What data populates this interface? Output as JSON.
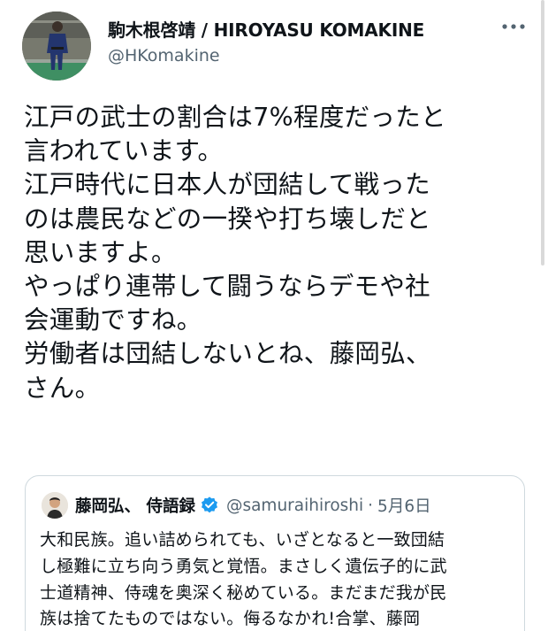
{
  "author": {
    "display_name": "駒木根啓靖 / HIROYASU KOMAKINE",
    "handle": "@HKomakine",
    "avatar_icon": "judo-athlete-photo-avatar"
  },
  "more_icon": "more-horizontal-icon",
  "tweet": {
    "lines": [
      "江戸の武士の割合は7%程度だったと",
      "言われています。",
      "江戸時代に日本人が団結して戦った",
      "のは農民などの一揆や打ち壊しだと",
      "思いますよ。",
      "やっぱり連帯して闘うならデモや社",
      "会運動ですね。",
      "労働者は団結しないとね、藤岡弘、",
      "さん。"
    ]
  },
  "quote": {
    "display_name": "藤岡弘、 侍語録",
    "verified_icon": "verified-badge-icon",
    "verified_color": "#1d9bf0",
    "handle": "@samuraihiroshi",
    "separator": "·",
    "date": "5月6日",
    "lines": [
      "大和民族。追い詰められても、いざとなると一致団結",
      "し極難に立ち向う勇気と覚悟。まさしく遺伝子的に武",
      "士道精神、侍魂を奥深く秘めている。まだまだ我が民",
      "族は捨てたものではない。侮るなかれ!合掌、藤岡"
    ]
  },
  "colors": {
    "text": "#0f1419",
    "secondary": "#536471",
    "border": "#cfd9de",
    "accent": "#1d9bf0"
  }
}
